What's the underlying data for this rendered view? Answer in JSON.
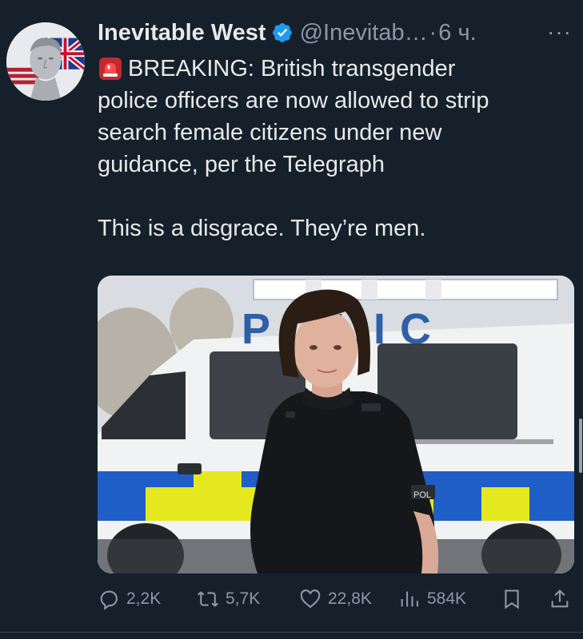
{
  "author": {
    "name": "Inevitable West",
    "handle": "@Inevitab…",
    "separator": "·",
    "time": "6 ч.",
    "more_label": "···"
  },
  "tweet": {
    "line1": "BREAKING: British transgender",
    "line2": "police officers are now allowed to strip",
    "line3": "search female citizens under new",
    "line4": "guidance, per the Telegraph",
    "line5": "This is a disgrace. They’re men."
  },
  "media": {
    "van_text": "POLIC",
    "badge_text": "POL"
  },
  "actions": {
    "replies": "2,2K",
    "retweets": "5,7K",
    "likes": "22,8K",
    "views": "584K"
  },
  "colors": {
    "background": "#15202b",
    "text_primary": "#e7e9ea",
    "text_secondary": "#8b98a5",
    "verified_blue": "#1d9bf0",
    "siren_red": "#e0245e"
  },
  "icons": {
    "verified": "verified-badge-icon",
    "siren": "police-siren-icon",
    "reply": "reply-icon",
    "retweet": "retweet-icon",
    "like": "heart-icon",
    "views": "views-icon",
    "bookmark": "bookmark-icon",
    "share": "share-icon"
  }
}
